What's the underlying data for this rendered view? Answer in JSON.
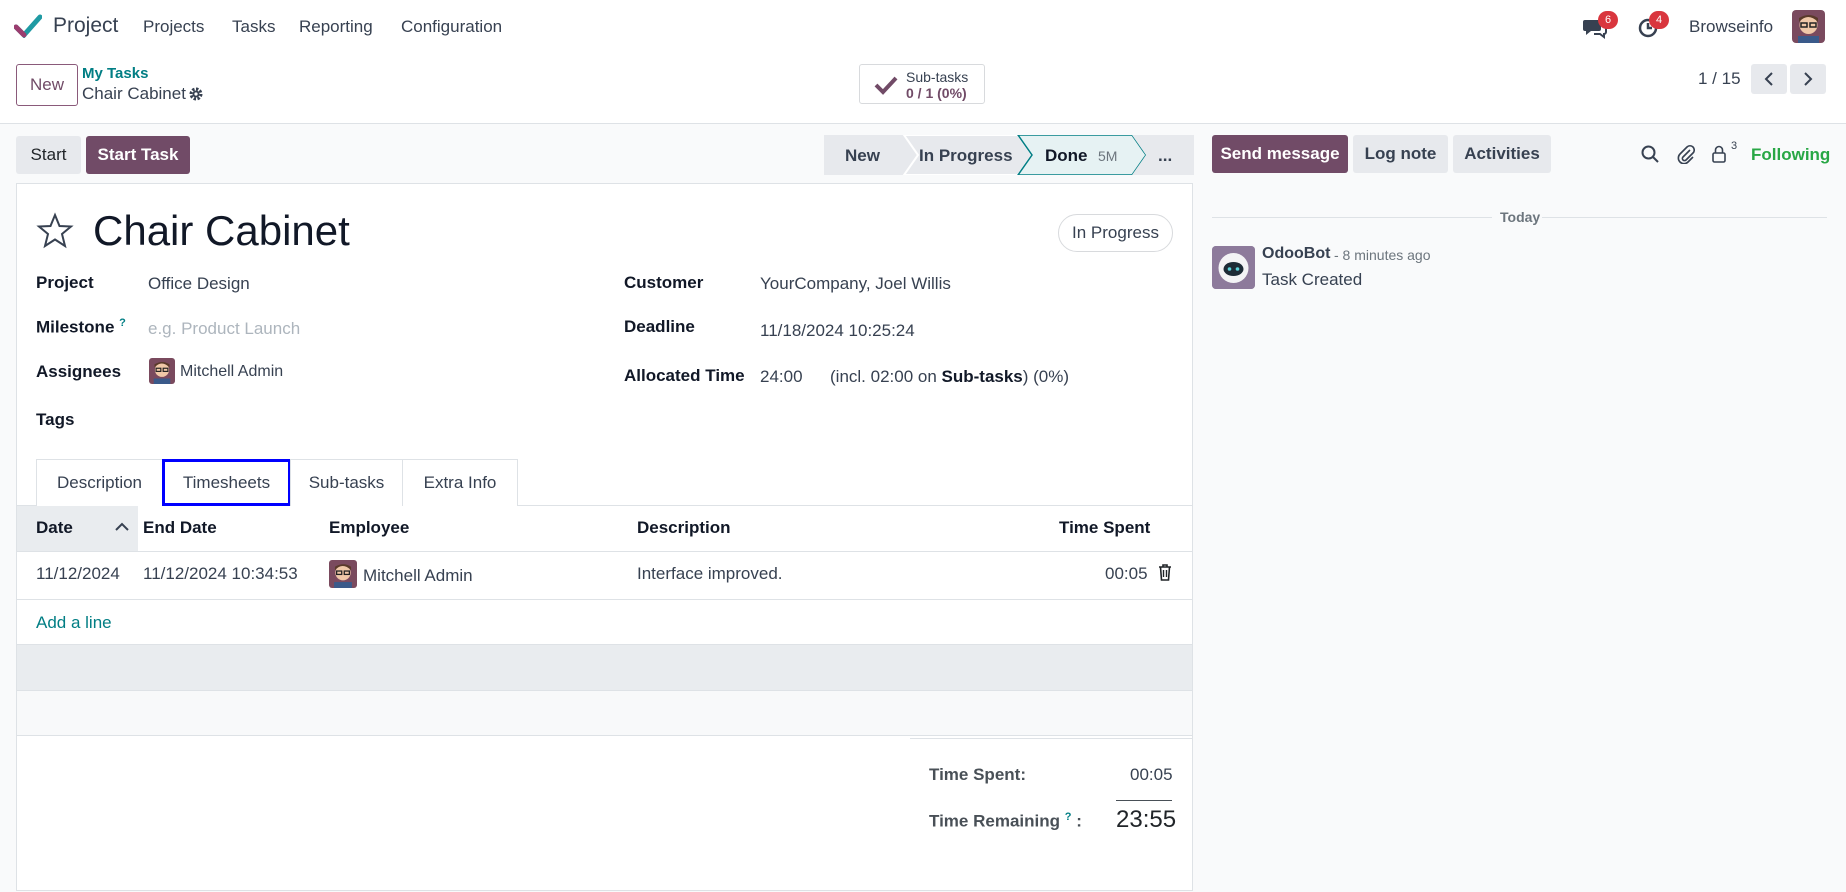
{
  "app": {
    "name": "Project"
  },
  "menu": [
    "Projects",
    "Tasks",
    "Reporting",
    "Configuration"
  ],
  "systray": {
    "messages_count": "6",
    "activities_count": "4",
    "company": "Browseinfo"
  },
  "control": {
    "new_label": "New",
    "breadcrumb_parent": "My Tasks",
    "breadcrumb_current": "Chair Cabinet",
    "subtasks_label": "Sub-tasks",
    "subtasks_value": "0 / 1 (0%)",
    "pager": "1 / 15"
  },
  "statusbar": {
    "start_label": "Start",
    "start_task_label": "Start Task",
    "stages": [
      "New",
      "In Progress",
      "Done"
    ],
    "done_duration": "5M",
    "more_label": "..."
  },
  "task": {
    "title": "Chair Cabinet",
    "state": "In Progress",
    "project_label": "Project",
    "project": "Office Design",
    "milestone_label": "Milestone",
    "milestone_help": "?",
    "milestone_placeholder": "e.g. Product Launch",
    "assignees_label": "Assignees",
    "assignee": "Mitchell Admin",
    "tags_label": "Tags",
    "customer_label": "Customer",
    "customer": "YourCompany, Joel Willis",
    "deadline_label": "Deadline",
    "deadline": "11/18/2024 10:25:24",
    "allocated_label": "Allocated Time",
    "allocated": "24:00",
    "allocated_note_pre": "(incl. 02:00 on ",
    "allocated_note_bold": "Sub-tasks",
    "allocated_note_post": ") (0%)"
  },
  "tabs": [
    "Description",
    "Timesheets",
    "Sub-tasks",
    "Extra Info"
  ],
  "timesheet": {
    "columns": [
      "Date",
      "End Date",
      "Employee",
      "Description",
      "Time Spent"
    ],
    "rows": [
      {
        "date": "11/12/2024",
        "end_date": "11/12/2024 10:34:53",
        "employee": "Mitchell Admin",
        "description": "Interface improved.",
        "time_spent": "00:05"
      }
    ],
    "add_line": "Add a line"
  },
  "totals": {
    "time_spent_label": "Time Spent:",
    "time_spent": "00:05",
    "time_remaining_label": "Time Remaining",
    "time_remaining_help": "?",
    "time_remaining_colon": ":",
    "time_remaining": "23:55"
  },
  "chatter": {
    "send_message": "Send message",
    "log_note": "Log note",
    "activities": "Activities",
    "followers_count": "3",
    "following": "Following",
    "date_separator": "Today",
    "author": "OdooBot",
    "time_ago": "- 8 minutes ago",
    "message": "Task Created"
  },
  "colors": {
    "brand": "#714B67",
    "link": "#017e84",
    "following": "#28a745",
    "badge": "#d9363e",
    "highlight": "#0000ff"
  }
}
